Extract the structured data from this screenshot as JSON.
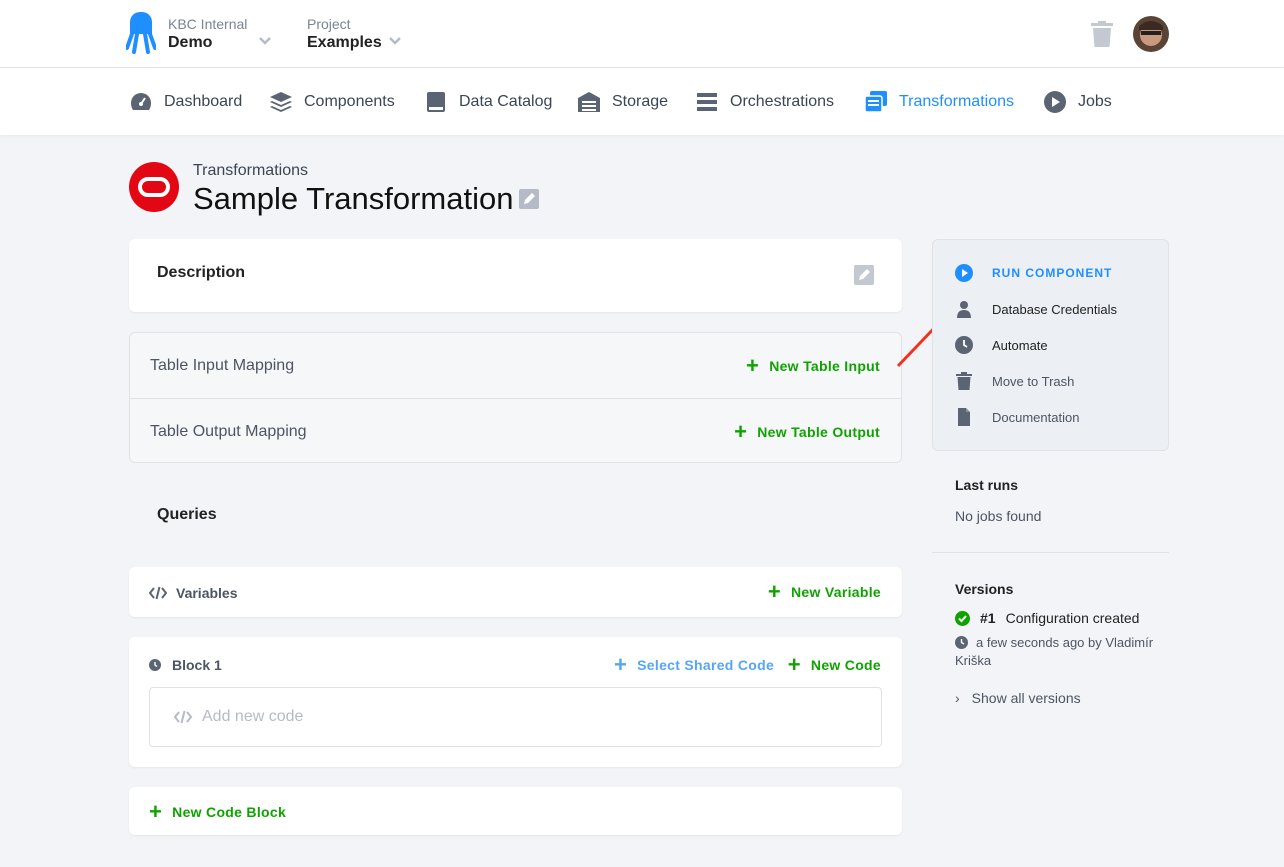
{
  "header": {
    "org_small": "KBC Internal",
    "org_name": "Demo",
    "project_small": "Project",
    "project_name": "Examples"
  },
  "nav": {
    "items": [
      {
        "label": "Dashboard",
        "icon": "dashboard-icon"
      },
      {
        "label": "Components",
        "icon": "layers-icon"
      },
      {
        "label": "Data Catalog",
        "icon": "book-icon"
      },
      {
        "label": "Storage",
        "icon": "warehouse-icon"
      },
      {
        "label": "Orchestrations",
        "icon": "bars-icon"
      },
      {
        "label": "Transformations",
        "icon": "transformations-icon",
        "active": true
      },
      {
        "label": "Jobs",
        "icon": "play-circle-icon"
      }
    ]
  },
  "page": {
    "breadcrumb": "Transformations",
    "title": "Sample Transformation"
  },
  "description": {
    "title": "Description"
  },
  "mapping": {
    "input_label": "Table Input Mapping",
    "input_action": "New Table Input",
    "output_label": "Table Output Mapping",
    "output_action": "New Table Output"
  },
  "queries": {
    "title": "Queries",
    "variables_label": "Variables",
    "new_variable": "New Variable",
    "block_label": "Block 1",
    "select_shared": "Select Shared Code",
    "new_code": "New Code",
    "code_placeholder": "Add new code",
    "new_block": "New Code Block"
  },
  "sidebar": {
    "run": "RUN COMPONENT",
    "items": [
      {
        "label": "Database Credentials",
        "icon": "user-icon"
      },
      {
        "label": "Automate",
        "icon": "clock-icon"
      },
      {
        "label": "Move to Trash",
        "icon": "trash-icon"
      },
      {
        "label": "Documentation",
        "icon": "file-icon"
      }
    ],
    "last_runs_title": "Last runs",
    "last_runs_empty": "No jobs found",
    "versions_title": "Versions",
    "version_num": "#1",
    "version_desc": "Configuration created",
    "version_meta": "a few seconds ago by Vladimír Kriška",
    "show_all": "Show all versions"
  },
  "colors": {
    "accent": "#1f8fff",
    "success": "#0fa300",
    "brand_red": "#e30613"
  }
}
